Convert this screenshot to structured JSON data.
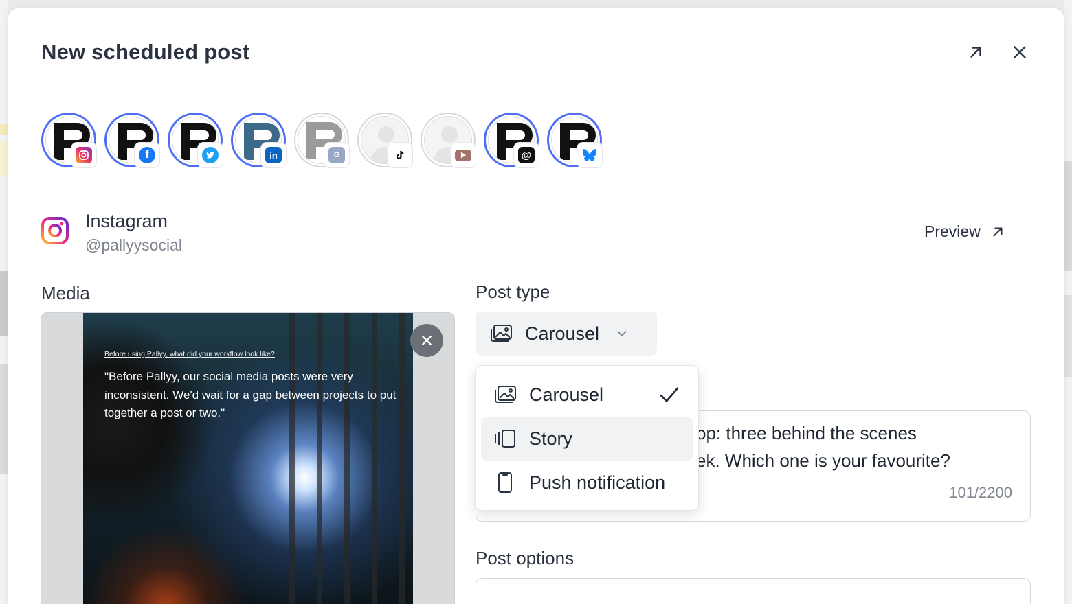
{
  "modal": {
    "title": "New scheduled post"
  },
  "accounts": [
    {
      "platform": "Instagram",
      "icon": "instagram-icon",
      "selected": true
    },
    {
      "platform": "Facebook",
      "icon": "facebook-icon",
      "selected": true
    },
    {
      "platform": "Twitter",
      "icon": "twitter-icon",
      "selected": true
    },
    {
      "platform": "LinkedIn",
      "icon": "linkedin-icon",
      "selected": true
    },
    {
      "platform": "Google Business",
      "icon": "google-business-icon",
      "selected": false
    },
    {
      "platform": "TikTok",
      "icon": "tiktok-icon",
      "selected": false
    },
    {
      "platform": "YouTube",
      "icon": "youtube-icon",
      "selected": false
    },
    {
      "platform": "Threads",
      "icon": "threads-icon",
      "selected": true
    },
    {
      "platform": "Bluesky",
      "icon": "bluesky-icon",
      "selected": true
    }
  ],
  "platform": {
    "name": "Instagram",
    "handle": "@pallyysocial",
    "preview_label": "Preview"
  },
  "media": {
    "label": "Media",
    "image_question": "Before using Pallyy, what did your workflow look like?",
    "image_quote": "\"Before Pallyy, our social media posts were very inconsistent. We'd wait for a gap between projects to put together a post or two.\""
  },
  "post_type": {
    "label": "Post type",
    "selected": "Carousel",
    "options": [
      {
        "label": "Carousel",
        "icon": "carousel-icon",
        "checked": true
      },
      {
        "label": "Story",
        "icon": "story-icon",
        "checked": false
      },
      {
        "label": "Push notification",
        "icon": "phone-icon",
        "checked": false
      }
    ]
  },
  "caption": {
    "text_line1": "op: three behind the scenes",
    "text_line2": "ek. Which one is your favourite?",
    "count": "101/2200"
  },
  "post_options": {
    "label": "Post options"
  },
  "colors": {
    "accent": "#4f6ef2",
    "text": "#1f2733",
    "muted": "#80868f"
  }
}
